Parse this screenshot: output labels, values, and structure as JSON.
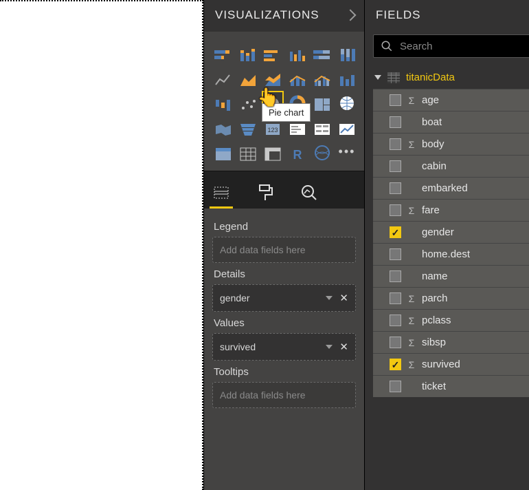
{
  "canvas": {},
  "visualizations": {
    "title": "VISUALIZATIONS",
    "tooltip": "Pie chart",
    "wells": {
      "legend": {
        "label": "Legend",
        "placeholder": "Add data fields here"
      },
      "details": {
        "label": "Details",
        "value": "gender"
      },
      "values_well": {
        "label": "Values",
        "value": "survived"
      },
      "tooltips": {
        "label": "Tooltips",
        "placeholder": "Add data fields here"
      }
    }
  },
  "fields": {
    "title": "FIELDS",
    "search_placeholder": "Search",
    "table_name": "titanicData",
    "columns": [
      {
        "name": "age",
        "sigma": true,
        "checked": false
      },
      {
        "name": "boat",
        "sigma": false,
        "checked": false
      },
      {
        "name": "body",
        "sigma": true,
        "checked": false
      },
      {
        "name": "cabin",
        "sigma": false,
        "checked": false
      },
      {
        "name": "embarked",
        "sigma": false,
        "checked": false
      },
      {
        "name": "fare",
        "sigma": true,
        "checked": false
      },
      {
        "name": "gender",
        "sigma": false,
        "checked": true
      },
      {
        "name": "home.dest",
        "sigma": false,
        "checked": false
      },
      {
        "name": "name",
        "sigma": false,
        "checked": false
      },
      {
        "name": "parch",
        "sigma": true,
        "checked": false
      },
      {
        "name": "pclass",
        "sigma": true,
        "checked": false
      },
      {
        "name": "sibsp",
        "sigma": true,
        "checked": false
      },
      {
        "name": "survived",
        "sigma": true,
        "checked": true
      },
      {
        "name": "ticket",
        "sigma": false,
        "checked": false
      }
    ]
  },
  "colors": {
    "accent": "#f2c811",
    "panel_bg": "#333232",
    "well_border": "#6a6a6a"
  }
}
